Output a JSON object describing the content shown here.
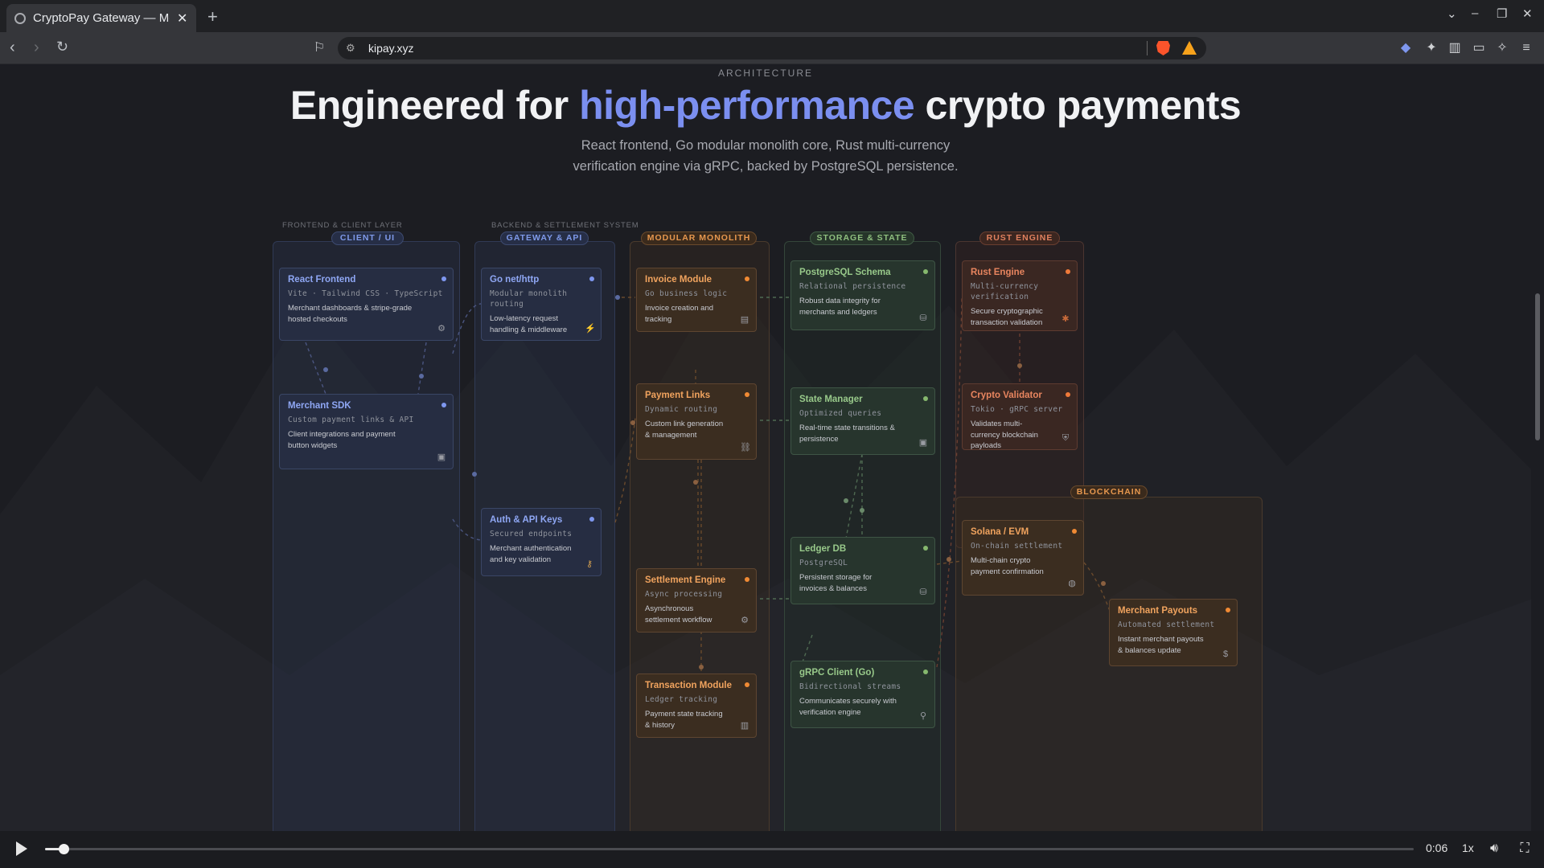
{
  "browser": {
    "tab_title": "CryptoPay Gateway — Me",
    "tab_close": "✕",
    "new_tab": "+",
    "url": "kipay.xyz",
    "window_controls": [
      "⌄",
      "–",
      "❐",
      "✕"
    ]
  },
  "page": {
    "eyebrow": "ARCHITECTURE",
    "headline_pre": "Engineered for ",
    "headline_highlight": "high-performance",
    "headline_post": " crypto payments",
    "subtext_line1": "React frontend, Go modular monolith core, Rust multi-currency",
    "subtext_line2": "verification engine via gRPC, backed by PostgreSQL persistence."
  },
  "diagram": {
    "layer_frontend": "FRONTEND & CLIENT LAYER",
    "layer_backend": "BACKEND & SETTLEMENT SYSTEM",
    "columns": {
      "client": "CLIENT / UI",
      "gateway": "GATEWAY & API",
      "monolith": "MODULAR MONOLITH",
      "storage": "STORAGE & STATE",
      "rust": "RUST ENGINE",
      "blockchain": "BLOCKCHAIN"
    },
    "cards": {
      "react": {
        "title": "React Frontend",
        "sub": "Vite · Tailwind CSS · TypeScript",
        "desc": "Merchant dashboards & stripe-grade hosted checkouts"
      },
      "sdk": {
        "title": "Merchant SDK",
        "sub": "Custom payment links & API",
        "desc": "Client integrations and payment button widgets"
      },
      "gonet": {
        "title": "Go net/http",
        "sub": "Modular monolith routing",
        "desc": "Low-latency request handling & middleware"
      },
      "auth": {
        "title": "Auth & API Keys",
        "sub": "Secured endpoints",
        "desc": "Merchant authentication and key validation"
      },
      "invoice": {
        "title": "Invoice Module",
        "sub": "Go business logic",
        "desc": "Invoice creation and tracking"
      },
      "links": {
        "title": "Payment Links",
        "sub": "Dynamic routing",
        "desc": "Custom link generation & management"
      },
      "settlement": {
        "title": "Settlement Engine",
        "sub": "Async processing",
        "desc": "Asynchronous settlement workflow"
      },
      "transaction": {
        "title": "Transaction Module",
        "sub": "Ledger tracking",
        "desc": "Payment state tracking & history"
      },
      "postgres": {
        "title": "PostgreSQL Schema",
        "sub": "Relational persistence",
        "desc": "Robust data integrity for merchants and ledgers"
      },
      "state": {
        "title": "State Manager",
        "sub": "Optimized queries",
        "desc": "Real-time state transitions & persistence"
      },
      "ledger": {
        "title": "Ledger DB",
        "sub": "PostgreSQL",
        "desc": "Persistent storage for invoices & balances"
      },
      "grpc": {
        "title": "gRPC Client (Go)",
        "sub": "Bidirectional streams",
        "desc": "Communicates securely with verification engine"
      },
      "rusteng": {
        "title": "Rust Engine",
        "sub": "Multi-currency verification",
        "desc": "Secure cryptographic transaction validation"
      },
      "validator": {
        "title": "Crypto Validator",
        "sub": "Tokio · gRPC server",
        "desc": "Validates multi-currency blockchain payloads"
      },
      "solana": {
        "title": "Solana / EVM",
        "sub": "On-chain settlement",
        "desc": "Multi-chain crypto payment confirmation"
      },
      "payouts": {
        "title": "Merchant Payouts",
        "sub": "Automated settlement",
        "desc": "Instant merchant payouts & balances update"
      }
    }
  },
  "video": {
    "time": "0:06",
    "speed": "1x",
    "progress": 0.011
  },
  "colors": {
    "accent_blue": "#7b8ff0",
    "orange": "#f08a34",
    "green": "#86b86e",
    "red": "#e8855f"
  }
}
